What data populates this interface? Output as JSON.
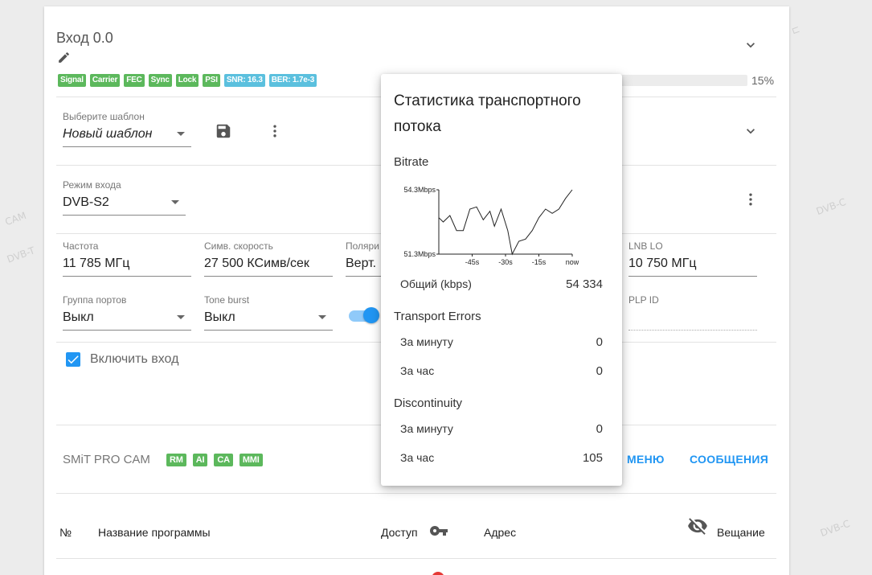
{
  "input": {
    "title": "Вход 0.0",
    "badges": [
      "Signal",
      "Carrier",
      "FEC",
      "Sync",
      "Lock",
      "PSI"
    ],
    "snr": "SNR: 16.3",
    "ber": "BER: 1.7e-3",
    "progress_percent": 15,
    "progress_label": "15%"
  },
  "template": {
    "label": "Выберите шаблон",
    "value": "Новый шаблон"
  },
  "mode": {
    "label": "Режим входа",
    "value": "DVB-S2"
  },
  "params": {
    "frequency_label": "Частота",
    "frequency_value": "11 785 МГц",
    "symbol_rate_label": "Симв. скорость",
    "symbol_rate_value": "27 500 КСимв/сек",
    "polarization_label": "Поляри",
    "polarization_value": "Верт.",
    "lnb_label": "LNB LO",
    "lnb_value": "10 750 МГц",
    "port_group_label": "Группа портов",
    "port_group_value": "Выкл",
    "tone_burst_label": "Tone burst",
    "tone_burst_value": "Выкл",
    "plp_label": "PLP ID",
    "plp_value": ""
  },
  "enable_input": {
    "label": "Включить вход",
    "checked": true
  },
  "cam": {
    "title": "SMiT PRO CAM",
    "badges": [
      "RM",
      "AI",
      "CA",
      "MMI"
    ],
    "menu_label": "МЕНЮ",
    "messages_label": "СООБЩЕНИЯ"
  },
  "table": {
    "col_num": "№",
    "col_name": "Название программы",
    "col_access": "Доступ",
    "col_address": "Адрес",
    "col_broadcast": "Вещание"
  },
  "colors": {
    "badge_green": "#5cb85c",
    "badge_blue": "#5bc0de",
    "accent": "#2196f3"
  },
  "popup": {
    "title": "Статистика транспортного потока",
    "bitrate_label": "Bitrate",
    "total_label": "Общий (kbps)",
    "total_value": "54 334",
    "errors_label": "Transport Errors",
    "errors_minute_label": "За минуту",
    "errors_minute_value": "0",
    "errors_hour_label": "За час",
    "errors_hour_value": "0",
    "discontinuity_label": "Discontinuity",
    "disc_minute_label": "За минуту",
    "disc_minute_value": "0",
    "disc_hour_label": "За час",
    "disc_hour_value": "105"
  },
  "chart_data": {
    "type": "line",
    "x_tick_labels": [
      "-45s",
      "-30s",
      "-15s",
      "now"
    ],
    "y_tick_labels": [
      "54.3Mbps",
      "51.3Mbps"
    ],
    "ylim": [
      51.3,
      54.3
    ],
    "xlim": [
      -60,
      0
    ],
    "x": [
      -60,
      -58,
      -55,
      -52,
      -49,
      -46,
      -43,
      -40,
      -37,
      -35,
      -32,
      -29,
      -27,
      -24,
      -21,
      -18,
      -15,
      -12,
      -9,
      -6,
      -3,
      0
    ],
    "y": [
      53.0,
      52.8,
      53.1,
      52.4,
      52.4,
      53.4,
      53.5,
      52.9,
      53.3,
      52.6,
      53.4,
      52.4,
      51.3,
      51.9,
      52.0,
      52.4,
      53.0,
      53.4,
      53.2,
      53.4,
      53.9,
      54.3
    ]
  }
}
